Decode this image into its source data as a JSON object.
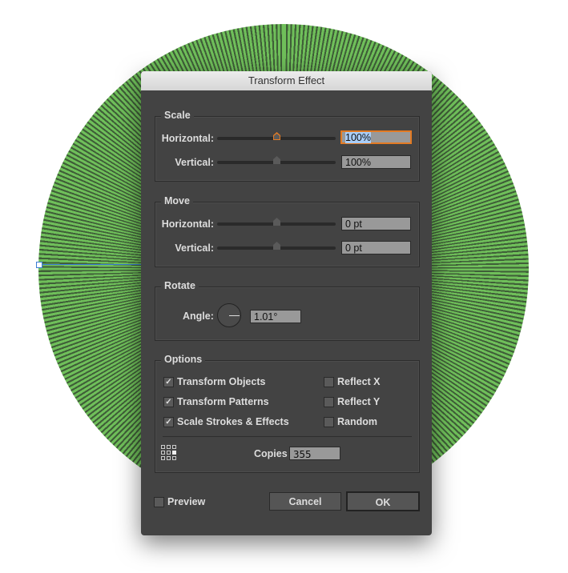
{
  "dialog": {
    "title": "Transform Effect"
  },
  "scale": {
    "title": "Scale",
    "horizontal_label": "Horizontal:",
    "horizontal_value": "100%",
    "vertical_label": "Vertical:",
    "vertical_value": "100%"
  },
  "move": {
    "title": "Move",
    "horizontal_label": "Horizontal:",
    "horizontal_value": "0 pt",
    "vertical_label": "Vertical:",
    "vertical_value": "0 pt"
  },
  "rotate": {
    "title": "Rotate",
    "angle_label": "Angle:",
    "angle_value": "1.01°"
  },
  "options": {
    "title": "Options",
    "transform_objects": "Transform Objects",
    "transform_patterns": "Transform Patterns",
    "scale_strokes": "Scale Strokes & Effects",
    "reflect_x": "Reflect X",
    "reflect_y": "Reflect Y",
    "random": "Random",
    "copies_label": "Copies",
    "copies_value": "355",
    "check": "✓"
  },
  "footer": {
    "preview": "Preview",
    "cancel": "Cancel",
    "ok": "OK"
  }
}
